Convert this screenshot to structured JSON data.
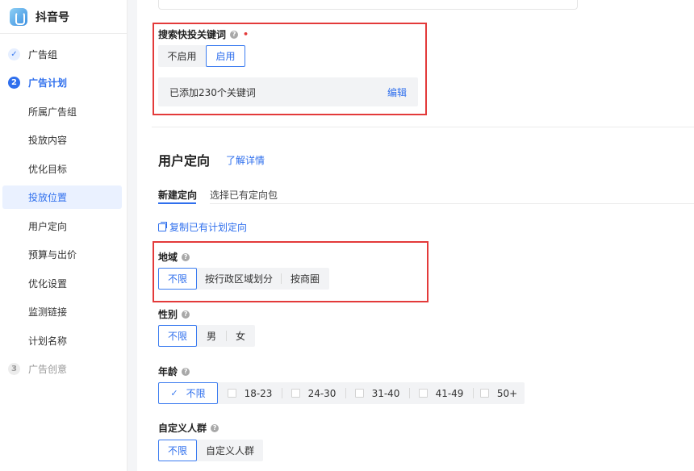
{
  "app": {
    "name": "抖音号"
  },
  "sidebar": {
    "steps": [
      {
        "badge": "✓",
        "label": "广告组"
      },
      {
        "badge": "2",
        "label": "广告计划"
      },
      {
        "badge": "3",
        "label": "广告创意"
      }
    ],
    "sub_items": [
      "所属广告组",
      "投放内容",
      "优化目标",
      "投放位置",
      "用户定向",
      "预算与出价",
      "优化设置",
      "监测链接",
      "计划名称"
    ],
    "active_sub": "投放位置"
  },
  "search_keywords": {
    "label": "搜索快投关键词",
    "required_mark": "•",
    "options": [
      "不启用",
      "启用"
    ],
    "selected": "启用",
    "summary": "已添加230个关键词",
    "edit_link": "编辑"
  },
  "user_targeting": {
    "title": "用户定向",
    "detail_link": "了解详情",
    "tabs": [
      "新建定向",
      "选择已有定向包"
    ],
    "active_tab": "新建定向",
    "copy_link": "复制已有计划定向"
  },
  "region": {
    "label": "地域",
    "options": [
      "不限",
      "按行政区域划分",
      "按商圈"
    ],
    "selected": "不限"
  },
  "gender": {
    "label": "性别",
    "options": [
      "不限",
      "男",
      "女"
    ],
    "selected": "不限"
  },
  "age": {
    "label": "年龄",
    "options": [
      "不限",
      "18-23",
      "24-30",
      "31-40",
      "41-49",
      "50+"
    ],
    "selected": "不限"
  },
  "custom_audience": {
    "label": "自定义人群",
    "options": [
      "不限",
      "自定义人群"
    ],
    "selected": "不限"
  },
  "colors": {
    "accent": "#2f6fed",
    "highlight_box": "#e33a3a"
  },
  "icons": [
    "logo-icon",
    "check-icon",
    "help-icon",
    "copy-icon"
  ]
}
